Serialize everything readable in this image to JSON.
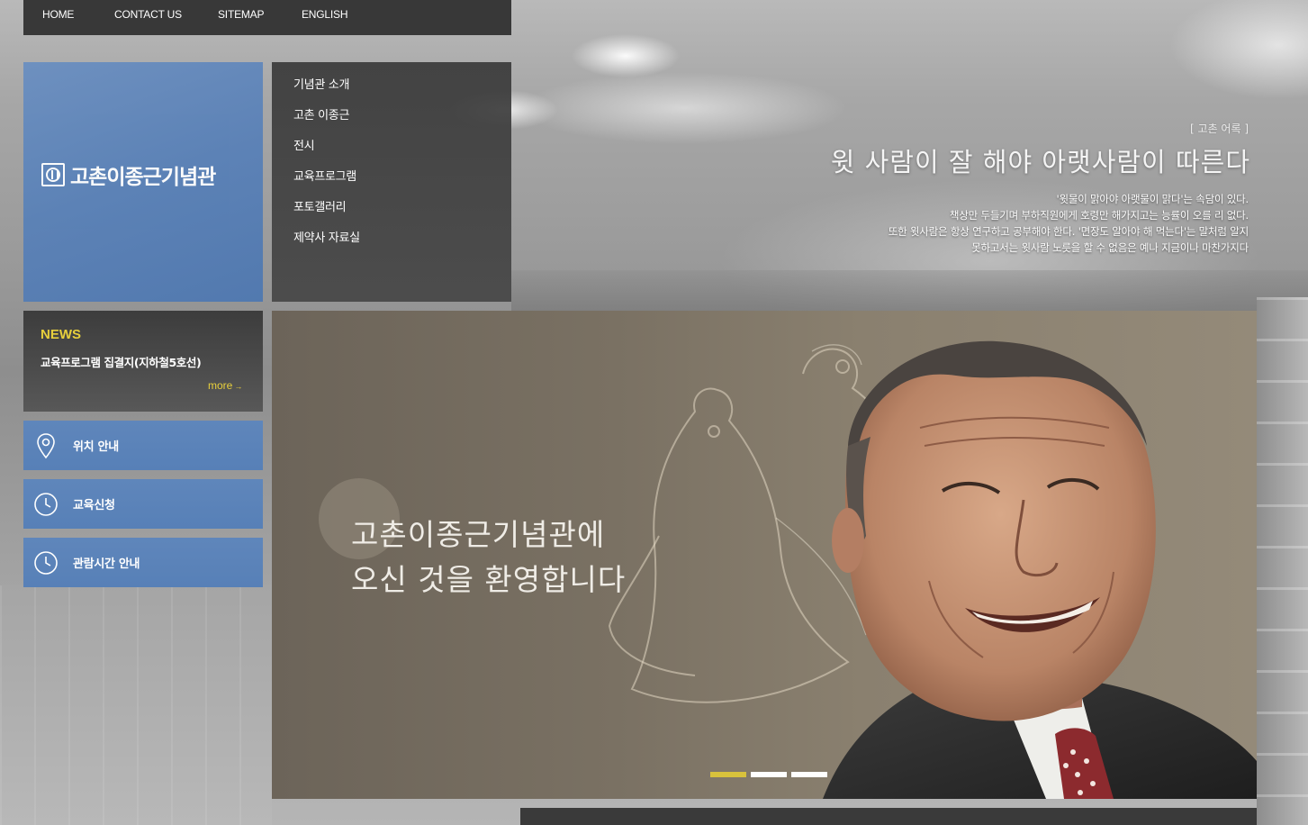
{
  "topnav": {
    "items": [
      "HOME",
      "CONTACT US",
      "SITEMAP",
      "ENGLISH"
    ]
  },
  "logo": {
    "text": "고촌이종근기념관",
    "color": "#5a81b7"
  },
  "menu": {
    "items": [
      "기념관 소개",
      "고촌 이종근",
      "전시",
      "교육프로그램",
      "포토갤러리",
      "제약사 자료실"
    ]
  },
  "news": {
    "title": "NEWS",
    "item": "교육프로그램 집결지(지하철5호선)",
    "more": "more"
  },
  "quick": [
    {
      "label": "위치 안내",
      "icon": "map-pin-icon"
    },
    {
      "label": "교육신청",
      "icon": "clock-icon"
    },
    {
      "label": "관람시간 안내",
      "icon": "clock-icon"
    }
  ],
  "quote": {
    "tag": "[ 고촌 어록 ]",
    "headline": "윗 사람이 잘 해야 아랫사람이 따른다",
    "lines": [
      "'윗물이 맑아야 아랫물이 맑다'는 속담이 있다.",
      "책상만 두들기며 부하직원에게 호령만 해가지고는 능률이 오를 리 없다.",
      "또한 윗사람은 항상 연구하고 공부해야 한다. '면장도 알아야 해 먹는다'는 말처럼 알지",
      "못하고서는 윗사람 노릇을 할 수 없음은 예나 지금이나 마찬가지다"
    ]
  },
  "hero": {
    "line1": "고촌이종근기념관에",
    "line2": "오신 것을 환영합니다",
    "slides": 3,
    "active_slide": 1,
    "accent_color": "#d8c23c"
  }
}
